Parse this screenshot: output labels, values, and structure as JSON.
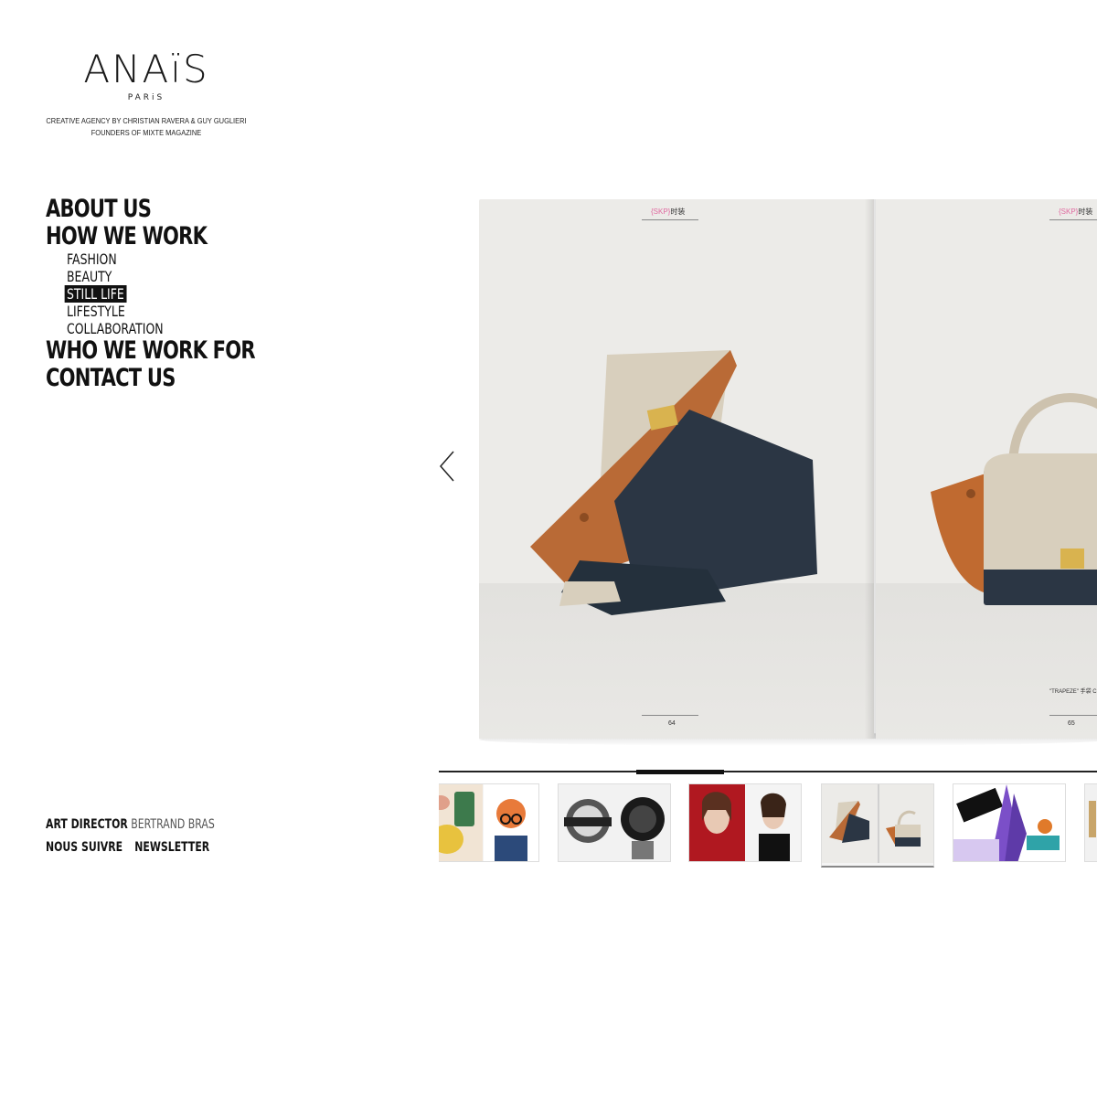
{
  "brand": {
    "name": "ANAïS",
    "sub": "PARiS"
  },
  "tagline": {
    "line1": "CREATIVE AGENCY BY CHRISTIAN RAVERA & GUY GUGLIERI",
    "line2": "FOUNDERS OF MIXTE MAGAZINE"
  },
  "menu": {
    "about": "ABOUT US",
    "how": "HOW WE WORK",
    "sub": [
      "FASHION",
      "BEAUTY",
      "STILL LIFE",
      "LIFESTYLE",
      "COLLABORATION"
    ],
    "active_sub": "STILL LIFE",
    "who": "WHO WE WORK FOR",
    "contact": "CONTACT US"
  },
  "footer": {
    "role": "ART DIRECTOR",
    "name": "BERTRAND BRAS",
    "follow": "NOUS SUIVRE",
    "newsletter": "NEWSLETTER"
  },
  "spread": {
    "left_header": "{SKP}时装",
    "left_header_tag": "{SKP}",
    "left_header_word": "时装",
    "right_header_tag": "{SKP}",
    "right_header_word": "时装",
    "left_folio": "64",
    "right_folio": "65",
    "caption": "\"TRAPEZE\" 手袋 CELINE"
  },
  "icons": {
    "prev": "chevron-left-icon"
  },
  "colors": {
    "accent": "#111111",
    "page": "#ecebe8",
    "tan": "#b96a36",
    "navy": "#2b3644",
    "beige": "#d8cfbd",
    "gold": "#d9b34f"
  }
}
